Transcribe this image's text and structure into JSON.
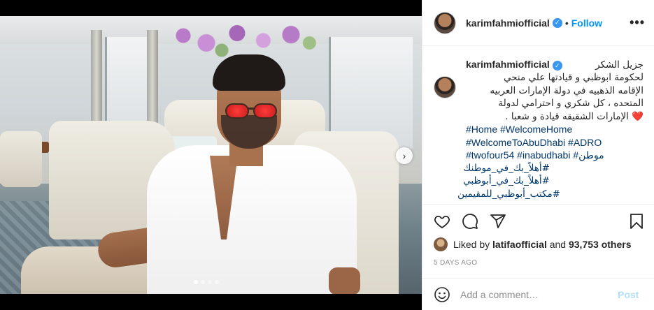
{
  "post": {
    "username": "karimfahmiofficial",
    "follow_label": "Follow",
    "separator": "•",
    "more_label": "•••"
  },
  "caption": {
    "username": "karimfahmiofficial",
    "lines": [
      "جزيل الشكر",
      "لحكومة ابوظبي و قيادتها علي منحي",
      "الإقامه الذهبيه في دولة الإمارات العربيه",
      "المتحده ، كل شكري و احترامي لدولة",
      "الإمارات الشقيقه قيادة و شعبا ."
    ],
    "heart": "❤️",
    "hashtags_ltr": [
      "#Home #WelcomeHome",
      "#WelcomeToAbuDhabi #ADRO",
      "#twofour54 #inabudhabi #موطن"
    ],
    "hashtags_rtl": [
      "#أهلاً_بك_في_موطنك",
      "#أهلاً_بك_في_أبوظبي",
      "#مكتب_أبوظبي_للمقيمين"
    ]
  },
  "likes": {
    "prefix": "Liked by",
    "user": "latifaofficial",
    "and": "and",
    "others": "93,753 others"
  },
  "date": "5 DAYS AGO",
  "comment": {
    "placeholder": "Add a comment…",
    "post_label": "Post"
  },
  "media": {
    "next_label": "›",
    "slides": 4,
    "active_slide": 1
  },
  "colors": {
    "link": "#0095f6",
    "hashtag": "#00376b",
    "verified": "#3897f0",
    "muted": "#8e8e8e",
    "post_disabled": "#b2dffc"
  }
}
